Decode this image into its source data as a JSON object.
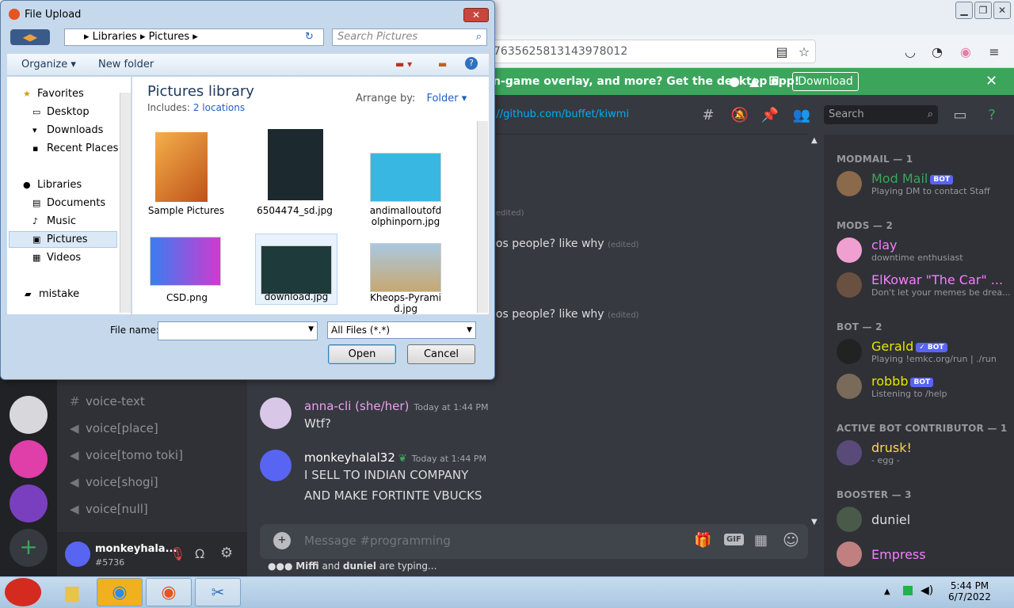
{
  "dialog": {
    "title": "File Upload",
    "breadcrumb": [
      "Libraries",
      "Pictures"
    ],
    "search_placeholder": "Search Pictures",
    "toolbar": {
      "organize": "Organize",
      "new_folder": "New folder"
    },
    "nav": {
      "favorites": "Favorites",
      "favorites_items": [
        "Desktop",
        "Downloads",
        "Recent Places"
      ],
      "libraries": "Libraries",
      "libraries_items": [
        "Documents",
        "Music",
        "Pictures",
        "Videos"
      ],
      "other": "mistake"
    },
    "library_title": "Pictures library",
    "includes_label": "Includes:",
    "includes_link": "2 locations",
    "arrange_label": "Arrange by:",
    "arrange_value": "Folder",
    "files": [
      {
        "name": "Sample Pictures"
      },
      {
        "name": "6504474_sd.jpg"
      },
      {
        "name": "andimalloutofd olphinporn.jpg"
      },
      {
        "name": "CSD.png"
      },
      {
        "name": "download.jpg"
      },
      {
        "name": "Kheops-Pyrami d.jpg"
      }
    ],
    "file_name_label": "File name:",
    "file_name_value": "",
    "filter_value": "All Files (*.*)",
    "open_label": "Open",
    "cancel_label": "Cancel"
  },
  "browser": {
    "url_fragment": "7635625813143978012"
  },
  "promo": {
    "text": "n-game overlay, and more? Get the desktop app!",
    "button": "Download"
  },
  "discord": {
    "topic": "://github.com/buffet/kiwmi",
    "search_placeholder": "Search",
    "fragments": [
      {
        "text": "",
        "edited": "(edited)"
      },
      {
        "text": "los people? like why",
        "edited": "(edited)"
      },
      {
        "text": "los people? like why",
        "edited": "(edited)"
      }
    ],
    "channels": [
      "voice-text",
      "voice[place]",
      "voice[tomo toki]",
      "voice[shogi]",
      "voice[null]"
    ],
    "user": {
      "name": "monkeyhala...",
      "tag": "#5736"
    },
    "messages": [
      {
        "author": "anna-cli (she/her)",
        "time": "Today at 1:44 PM",
        "lines": [
          "Wtf?"
        ],
        "color": "#e8a3f0"
      },
      {
        "author": "monkeyhalal32",
        "time": "Today at 1:44 PM",
        "lines": [
          "I SELL TO INDIAN COMPANY",
          "AND MAKE FORTINTE VBUCKS"
        ],
        "color": "#ffffff"
      }
    ],
    "message_placeholder": "Message #programming",
    "typing": {
      "user1": "Miffi",
      "and": "and",
      "user2": "duniel",
      "suffix": "are typing..."
    },
    "member_groups": [
      {
        "label": "MODMAIL — 1",
        "members": [
          {
            "name": "Mod Mail",
            "bot": "BOT",
            "sub": "Playing DM to contact Staff",
            "color": "#3ba55c"
          }
        ]
      },
      {
        "label": "MODS — 2",
        "members": [
          {
            "name": "clay",
            "sub": "downtime enthusiast",
            "color": "#f47fff"
          },
          {
            "name": "ElKowar \"The Car\" ...",
            "sub": "Don't let your memes be drea...",
            "color": "#f47fff"
          }
        ]
      },
      {
        "label": "BOT — 2",
        "members": [
          {
            "name": "Gerald",
            "bot": "✓ BOT",
            "sub": "Playing !emkc.org/run | ./run",
            "color": "#e6e600"
          },
          {
            "name": "robbb",
            "bot": "BOT",
            "sub": "Listening to /help",
            "color": "#e6e600"
          }
        ]
      },
      {
        "label": "ACTIVE BOT CONTRIBUTOR — 1",
        "members": [
          {
            "name": "drusk!",
            "sub": "- egg -",
            "color": "#ffd84a"
          }
        ]
      },
      {
        "label": "BOOSTER — 3",
        "members": [
          {
            "name": "duniel",
            "sub": "",
            "color": "#dcddde"
          },
          {
            "name": "Empress",
            "sub": "",
            "color": "#f47fff"
          }
        ]
      }
    ]
  },
  "taskbar": {
    "time": "5:44 PM",
    "date": "6/7/2022"
  }
}
